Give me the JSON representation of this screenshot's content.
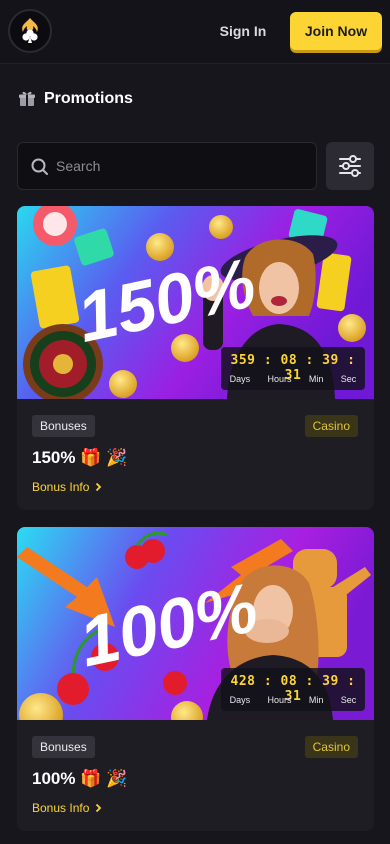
{
  "header": {
    "logo_icon": "club-flame-logo-icon",
    "sign_in_label": "Sign In",
    "join_label": "Join Now"
  },
  "page": {
    "title": "Promotions",
    "title_icon": "gift-icon"
  },
  "search": {
    "placeholder": "Search",
    "icon": "search-icon",
    "filter_icon": "sliders-icon"
  },
  "colors": {
    "accent": "#fcd535",
    "background": "#17161c",
    "card": "#1e1d24"
  },
  "promotions": [
    {
      "banner_text": "150%",
      "timer": {
        "days": "359",
        "hours": "08",
        "min": "39",
        "sec": "31"
      },
      "category": "Bonuses",
      "type": "Casino",
      "offer": "150% 🎁 🎉",
      "info_label": "Bonus Info"
    },
    {
      "banner_text": "100%",
      "timer": {
        "days": "428",
        "hours": "08",
        "min": "39",
        "sec": "31"
      },
      "category": "Bonuses",
      "type": "Casino",
      "offer": "100% 🎁 🎉",
      "info_label": "Bonus Info"
    }
  ],
  "timer_units": {
    "days": "Days",
    "hours": "Hours",
    "min": "Min",
    "sec": "Sec"
  }
}
